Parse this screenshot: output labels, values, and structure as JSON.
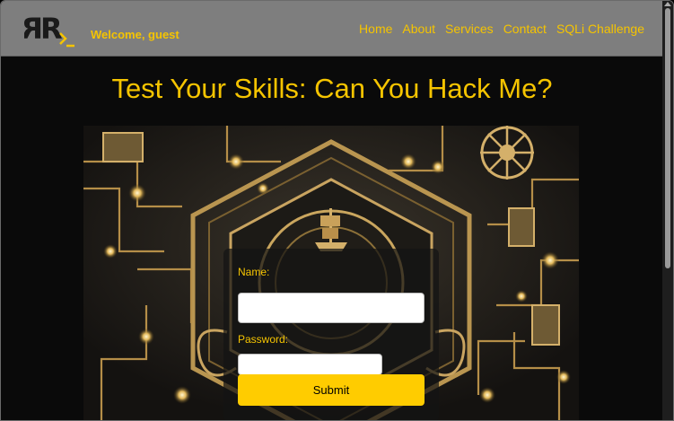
{
  "navbar": {
    "logo_text": "RR",
    "welcome": "Welcome, guest",
    "links": [
      {
        "label": "Home"
      },
      {
        "label": "About"
      },
      {
        "label": "Services"
      },
      {
        "label": "Contact"
      },
      {
        "label": "SQLi Challenge"
      }
    ]
  },
  "main": {
    "title": "Test Your Skills: Can You Hack Me?",
    "hero_image": "circuit-board-ship-image"
  },
  "login_form": {
    "name_label": "Name:",
    "name_value": "",
    "password_label": "Password:",
    "password_value": "",
    "submit_label": "Submit"
  },
  "colors": {
    "accent": "#f5c400",
    "navbar_bg": "#7e7e7e",
    "page_bg": "#0a0a0a",
    "button_bg": "#ffcc00"
  }
}
